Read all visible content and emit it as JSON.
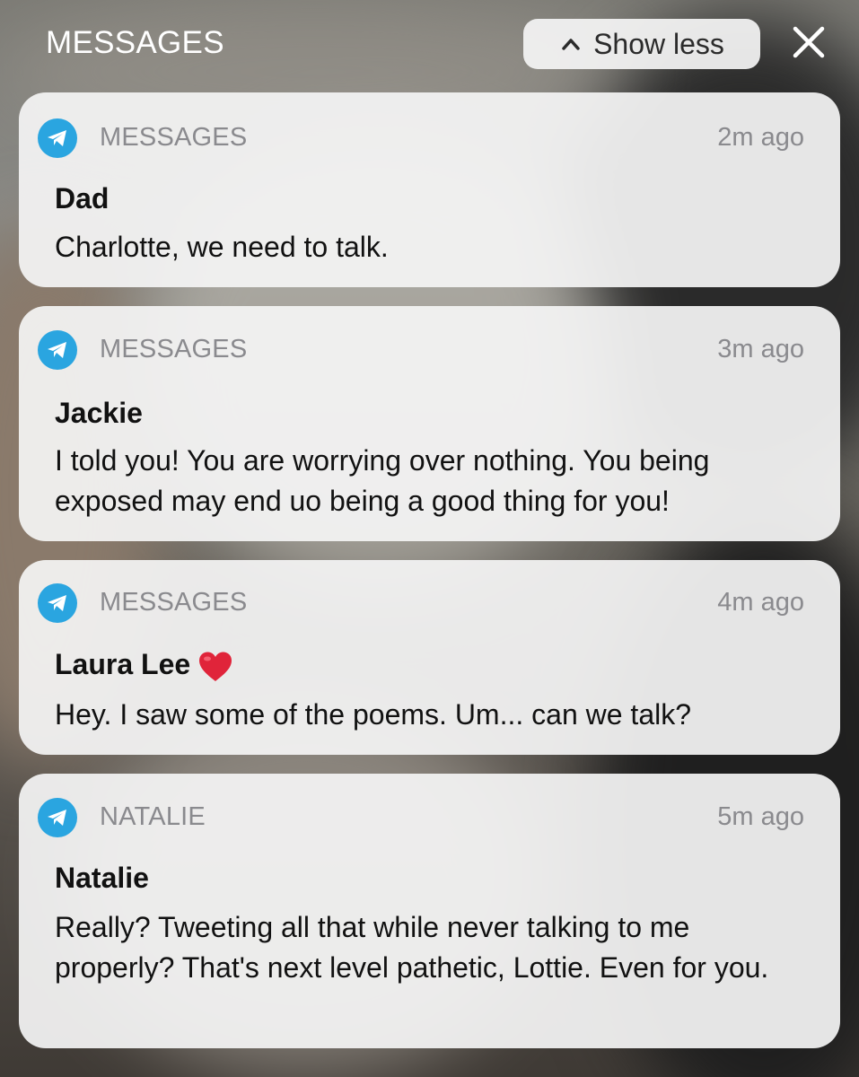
{
  "header": {
    "title": "MESSAGES",
    "show_less_label": "Show less",
    "icons": {
      "chevron": "chevron-up-icon",
      "close": "close-icon"
    }
  },
  "notifications": [
    {
      "app_name": "MESSAGES",
      "time": "2m ago",
      "sender": "Dad",
      "body": "Charlotte, we need to talk.",
      "icon": "telegram-icon"
    },
    {
      "app_name": "MESSAGES",
      "time": "3m ago",
      "sender": "Jackie",
      "body": "I told you! You are worrying over nothing. You being exposed may end uo being a good thing for you!",
      "icon": "telegram-icon"
    },
    {
      "app_name": "MESSAGES",
      "time": "4m ago",
      "sender": "Laura Lee",
      "sender_emoji": "heart-icon",
      "body": "Hey. I saw some of the poems. Um... can we talk?",
      "icon": "telegram-icon"
    },
    {
      "app_name": "NATALIE",
      "time": "5m ago",
      "sender": "Natalie",
      "body": "Really? Tweeting all that while never talking to me properly? That's next level pathetic, Lottie. Even for you.",
      "icon": "telegram-icon"
    }
  ],
  "colors": {
    "app_icon": "#2aa5e0",
    "card_bg": "#f4f4f4",
    "meta_text": "#8a8a8e",
    "heart": "#e0243a"
  }
}
